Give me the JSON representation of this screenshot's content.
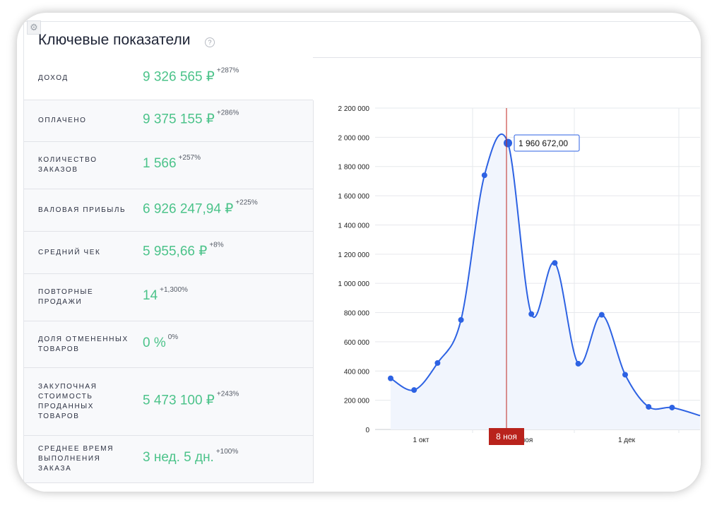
{
  "header": {
    "title": "Ключевые показатели",
    "help_icon": "question-circle-icon",
    "settings_icon": "gear-icon"
  },
  "metrics": [
    {
      "label": "ДОХОД",
      "value": "9 326 565 ₽",
      "change": "+287%"
    },
    {
      "label": "ОПЛАЧЕНО",
      "value": "9 375 155 ₽",
      "change": "+286%"
    },
    {
      "label": "КОЛИЧЕСТВО ЗАКАЗОВ",
      "value": "1 566",
      "change": "+257%"
    },
    {
      "label": "ВАЛОВАЯ ПРИБЫЛЬ",
      "value": "6 926 247,94 ₽",
      "change": "+225%"
    },
    {
      "label": "СРЕДНИЙ ЧЕК",
      "value": "5 955,66 ₽",
      "change": "+8%"
    },
    {
      "label": "ПОВТОРНЫЕ ПРОДАЖИ",
      "value": "14",
      "change": "+1,300%"
    },
    {
      "label": "ДОЛЯ ОТМЕНЕННЫХ ТОВАРОВ",
      "value": "0 %",
      "change": "0%"
    },
    {
      "label": "ЗАКУПОЧНАЯ СТОИМОСТЬ ПРОДАННЫХ ТОВАРОВ",
      "value": "5 473 100 ₽",
      "change": "+243%"
    },
    {
      "label": "СРЕДНЕЕ ВРЕМЯ ВЫПОЛНЕНИЯ ЗАКАЗА",
      "value": "3 нед. 5 дн.",
      "change": "+100%"
    }
  ],
  "chart_data": {
    "type": "area",
    "x": [
      "4 окт",
      "11 окт",
      "18 окт",
      "25 окт",
      "1 ноя",
      "8 ноя",
      "15 ноя",
      "22 ноя",
      "29 ноя",
      "6 дек",
      "13 дек",
      "20 дек",
      "27 дек"
    ],
    "values": [
      350000,
      270000,
      455000,
      750000,
      1740000,
      1960672,
      790000,
      1140000,
      450000,
      785000,
      375000,
      155000,
      150000
    ],
    "ylim": [
      0,
      2200000
    ],
    "yticks": [
      "0",
      "200 000",
      "400 000",
      "600 000",
      "800 000",
      "1 000 000",
      "1 200 000",
      "1 400 000",
      "1 600 000",
      "1 800 000",
      "2 000 000",
      "2 200 000"
    ],
    "xticks": [
      "1 окт",
      "ноя",
      "1 дек"
    ],
    "grid": true,
    "hover": {
      "x_label": "8 ноя",
      "tooltip": "1 960 672,00",
      "index": 5
    },
    "colors": {
      "line": "#2d62e3",
      "fill": "#f1f5fd",
      "cursor": "#c0261f",
      "badge": "#b9231c",
      "value": "#4cc38a"
    }
  }
}
